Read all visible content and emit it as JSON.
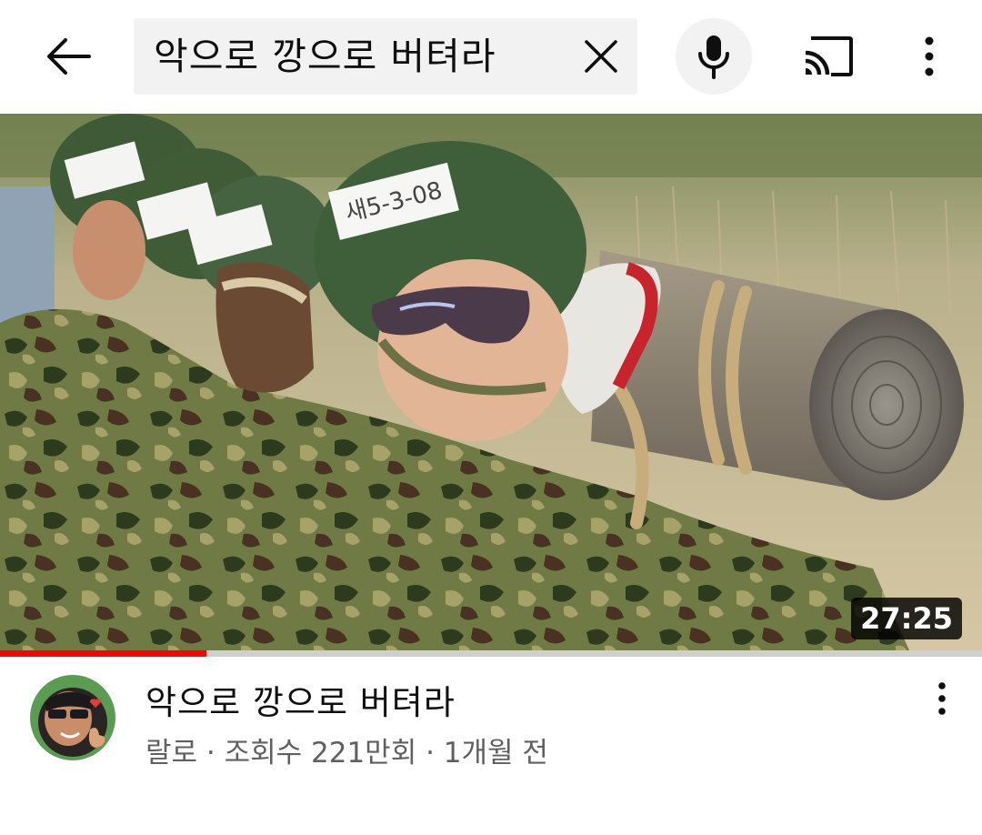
{
  "search": {
    "query": "악으로 깡으로 버텨라"
  },
  "icons": {
    "back": "arrow-left-icon",
    "clear": "close-icon",
    "mic": "microphone-icon",
    "cast": "cast-icon",
    "more": "more-vertical-icon"
  },
  "video": {
    "title": "악으로 깡으로 버텨라",
    "channel": "랄로",
    "views": "조회수 221만회",
    "age": "1개월 전",
    "subtitle": "랄로 · 조회수 221만회 · 1개월 전",
    "duration": "27:25",
    "watched_fraction": 0.21,
    "thumbnail_label": "새5-3-08"
  },
  "colors": {
    "progress": "#ff0000",
    "duration_bg": "#000000",
    "search_bg": "#f2f2f2"
  }
}
